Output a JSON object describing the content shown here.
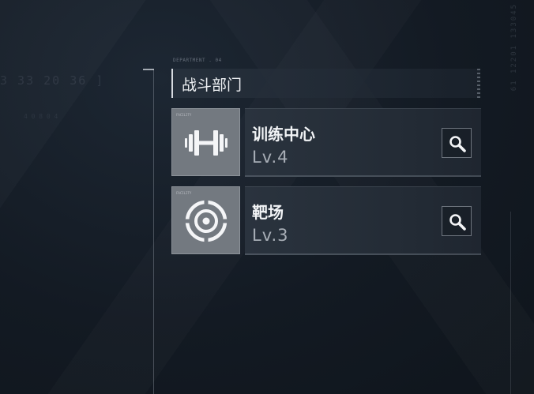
{
  "background": {
    "numbers": "3 33    20 36 ]",
    "sub": "4      0 8        0 4",
    "vertical": "61    12201    133045"
  },
  "department": {
    "caption": "DEPARTMENT . 04",
    "title": "战斗部门"
  },
  "facilities": [
    {
      "name": "训练中心",
      "level": "Lv.4",
      "icon": "dumbbell-icon",
      "tag": "FACILITY"
    },
    {
      "name": "靶场",
      "level": "Lv.3",
      "icon": "target-icon",
      "tag": "FACILITY"
    }
  ],
  "colors": {
    "background": "#131a23",
    "card": "#2a333e",
    "icon_tile": "#737980",
    "text": "#f2f4f6",
    "level_text": "#a8aeb6"
  }
}
